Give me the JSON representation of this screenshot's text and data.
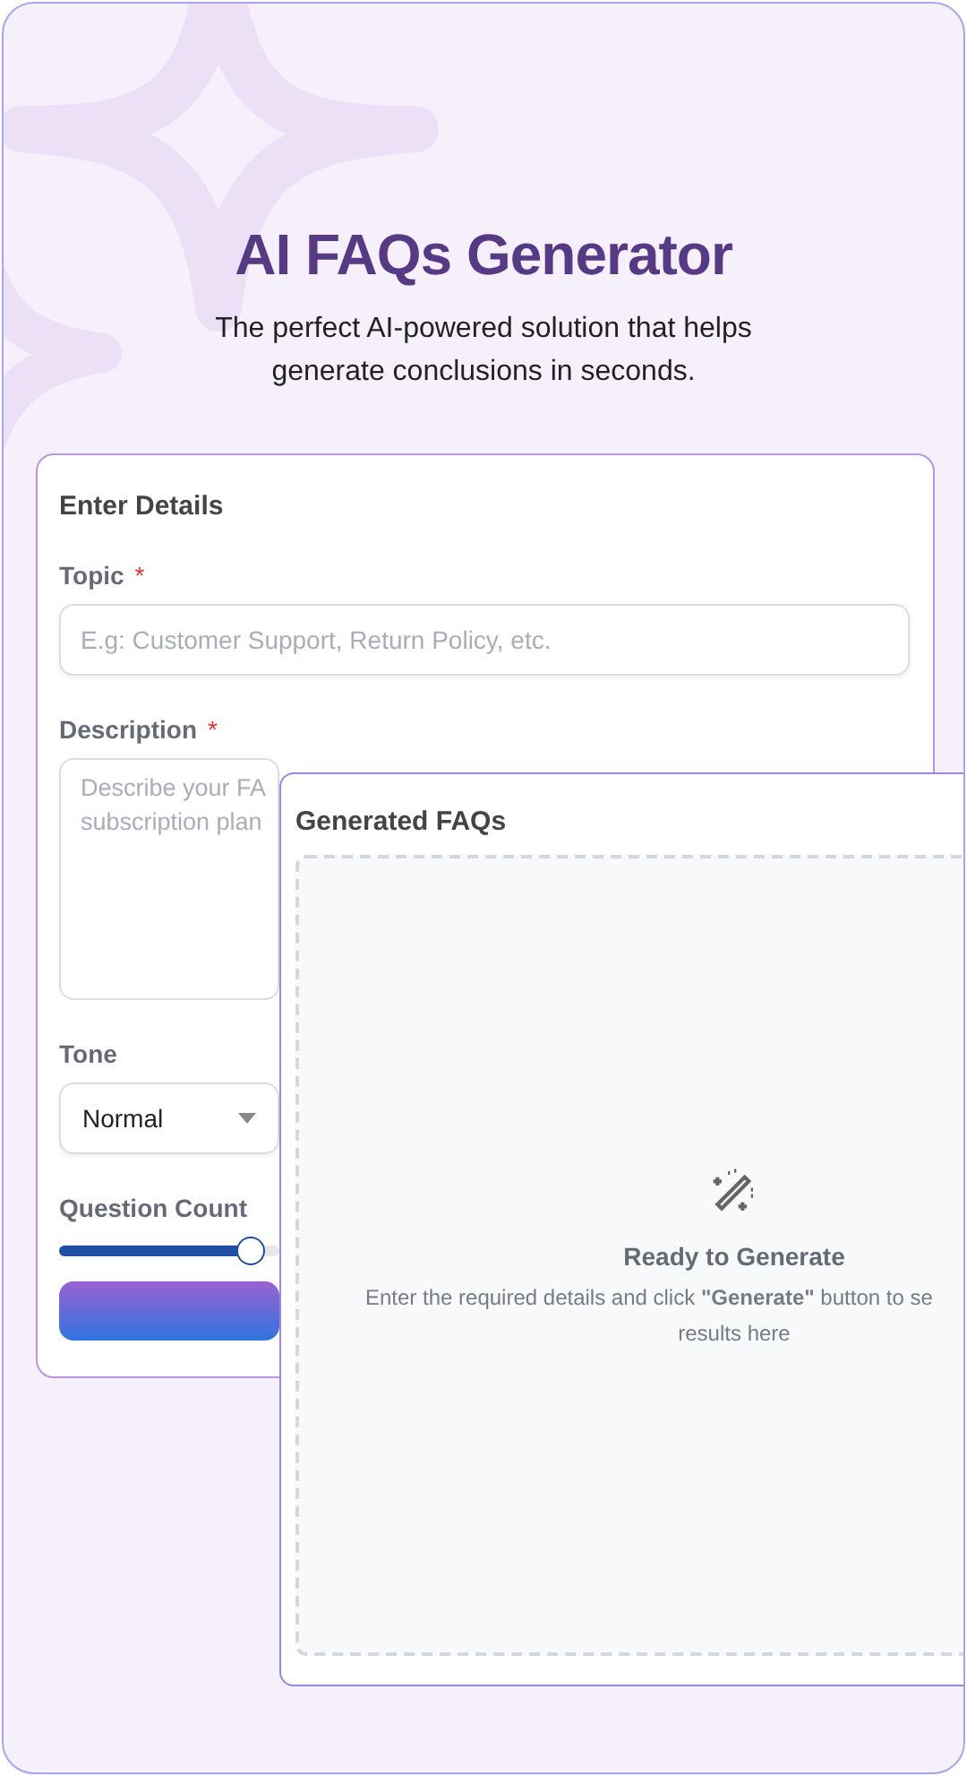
{
  "header": {
    "title": "AI FAQs Generator",
    "subtitle_lines": [
      "The perfect AI-powered solution that helps",
      "generate conclusions in seconds."
    ]
  },
  "form": {
    "heading": "Enter Details",
    "topic": {
      "label": "Topic",
      "required_mark": "*",
      "placeholder": "E.g: Customer Support, Return Policy, etc."
    },
    "description": {
      "label": "Description",
      "required_mark": "*",
      "placeholder_lines": [
        "Describe your FA",
        "subscription plan"
      ]
    },
    "tone": {
      "label": "Tone",
      "value": "Normal"
    },
    "question_count": {
      "label": "Question Count",
      "level": 0.87
    }
  },
  "results": {
    "heading": "Generated FAQs",
    "empty_title": "Ready to Generate",
    "empty_lines": [
      "Enter the required details and click **\"Generate\"** button to se",
      "results here"
    ]
  }
}
